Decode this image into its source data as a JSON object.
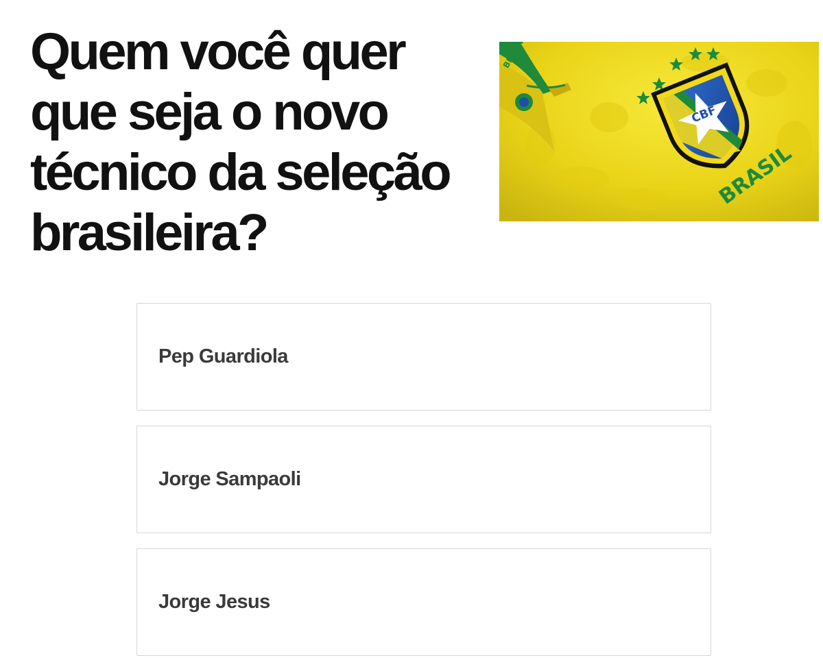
{
  "poll": {
    "question": "Quem você quer que seja o novo técnico da seleção brasileira?",
    "image": {
      "icon": "brazil-jersey-image",
      "crest_text": "CBF",
      "jersey_text": "BRASIL",
      "colors": {
        "yellow": "#f2d91a",
        "green": "#1f8a3b",
        "blue": "#1e4fa8"
      }
    },
    "options": [
      {
        "label": "Pep Guardiola"
      },
      {
        "label": "Jorge Sampaoli"
      },
      {
        "label": "Jorge Jesus"
      }
    ]
  }
}
